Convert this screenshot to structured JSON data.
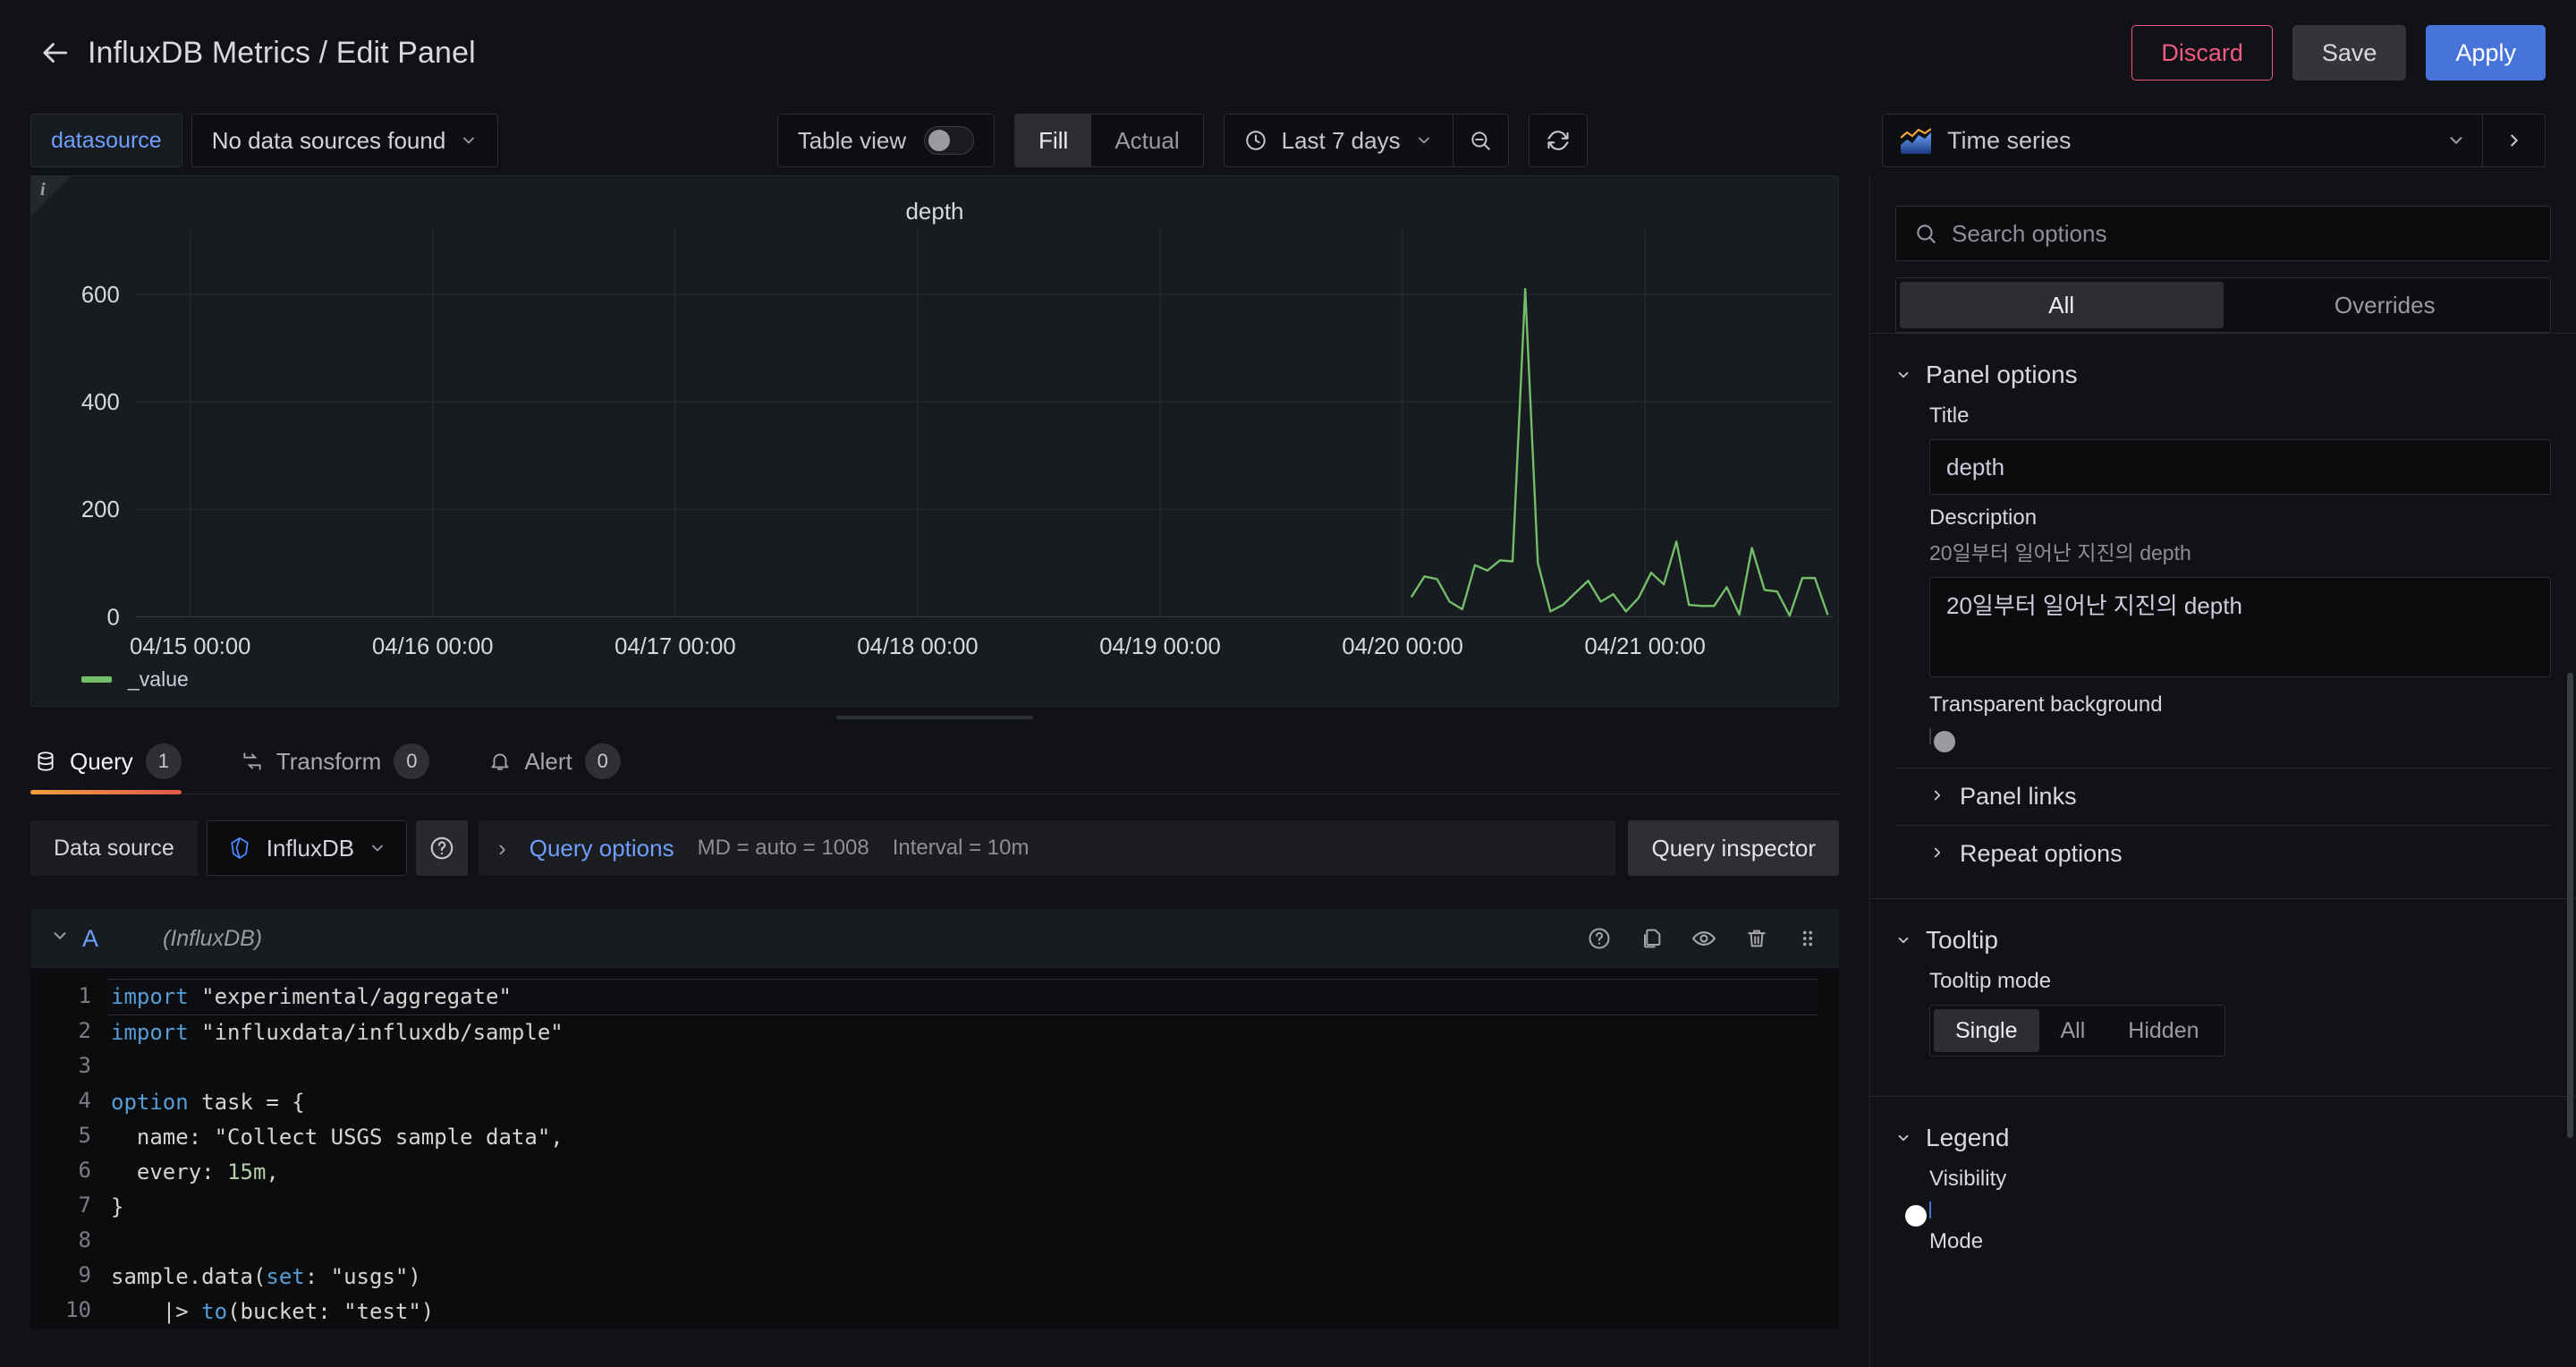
{
  "header": {
    "back_icon": "arrow-left-icon",
    "title": "InfluxDB Metrics / Edit Panel",
    "discard_label": "Discard",
    "save_label": "Save",
    "apply_label": "Apply",
    "discard_color": "#f45b82",
    "apply_color": "#4674db"
  },
  "toolbar": {
    "datasource_tag": "datasource",
    "datasource_value": "No data sources found",
    "table_view_label": "Table view",
    "table_view_on": false,
    "fill_label": "Fill",
    "actual_label": "Actual",
    "fill_actual_selected": "Fill",
    "time_range": "Last 7 days",
    "zoom_out_icon": "zoom-out-icon",
    "refresh_icon": "refresh-icon",
    "clock_icon": "clock-icon",
    "viz_type": "Time series",
    "viz_icon": "time-series-icon"
  },
  "panel": {
    "info_icon": "info-icon",
    "title": "depth"
  },
  "chart_data": {
    "type": "line",
    "title": "depth",
    "xlabel": "",
    "ylabel": "",
    "grid": true,
    "legend_position": "bottom-left",
    "series": [
      {
        "name": "_value",
        "color": "#73bf69",
        "values": [
          null,
          null,
          null,
          null,
          null,
          null,
          null,
          null,
          null,
          null,
          null,
          null,
          null,
          null,
          null,
          null,
          null,
          null,
          null,
          null,
          null,
          null,
          null,
          null,
          null,
          null,
          null,
          null,
          null,
          null,
          null,
          null,
          null,
          null,
          null,
          null,
          null,
          null,
          null,
          null,
          null,
          null,
          null,
          null,
          null,
          null,
          null,
          null,
          null,
          null,
          null,
          null,
          null,
          null,
          null,
          null,
          null,
          null,
          null,
          null,
          null,
          null,
          null,
          null,
          null,
          null,
          null,
          null,
          null,
          null,
          null,
          null,
          null,
          null,
          null,
          null,
          null,
          null,
          null,
          null,
          null,
          null,
          null,
          null,
          null,
          null,
          null,
          null,
          null,
          null,
          null,
          null,
          null,
          null,
          null,
          null,
          null,
          null,
          null,
          null,
          null,
          null,
          null,
          null,
          null,
          null,
          null,
          null,
          null,
          null,
          null,
          null,
          null,
          null,
          null,
          null,
          null,
          null,
          null,
          null,
          null,
          null,
          null,
          null,
          null,
          null,
          null,
          null,
          null,
          null,
          null,
          null,
          null,
          null,
          null,
          null,
          null,
          null,
          null,
          null,
          null,
          null,
          null,
          null,
          null,
          null,
          null,
          null,
          null,
          null,
          null,
          null,
          null,
          null,
          null,
          null,
          null,
          null,
          null,
          null,
          null,
          null,
          null,
          null,
          null,
          null,
          null,
          null,
          null,
          null,
          null,
          null,
          null,
          null,
          null,
          null,
          null,
          null,
          null,
          null,
          null,
          null,
          null,
          null,
          null,
          null,
          null,
          null,
          null,
          null,
          null,
          null,
          null,
          null,
          null,
          null,
          null,
          null,
          null,
          null,
          null,
          null,
          null,
          null,
          null,
          null,
          null,
          null,
          null,
          null,
          null,
          null,
          null,
          null,
          null,
          null,
          null,
          null,
          null,
          null,
          null,
          null,
          null,
          null,
          null,
          null,
          null,
          null,
          null,
          null,
          null,
          null,
          null,
          null,
          null,
          null,
          null,
          null,
          null,
          null,
          null,
          null,
          null,
          null,
          null,
          null,
          null,
          null,
          null,
          null,
          null,
          null,
          null,
          null,
          null,
          null,
          null,
          null,
          null,
          null,
          null,
          null,
          null,
          null,
          null,
          null,
          null,
          null,
          null,
          null,
          null,
          null,
          null,
          null,
          null,
          null,
          null,
          null,
          null,
          null,
          null,
          null,
          null,
          null,
          null,
          null,
          null,
          null,
          null,
          null,
          null,
          null,
          null,
          null,
          null,
          null,
          null,
          null,
          null,
          null,
          null,
          null,
          null,
          null,
          null,
          null,
          null,
          null,
          null,
          null,
          null,
          null,
          null,
          null,
          null,
          null,
          null,
          null,
          null,
          null,
          null,
          null,
          null,
          null,
          null,
          null,
          null,
          null,
          null,
          null,
          null,
          null,
          null,
          null,
          null,
          null,
          null,
          null,
          null,
          null,
          null,
          null,
          null,
          null,
          null,
          null,
          null,
          null,
          null,
          null,
          null,
          null,
          null,
          null,
          null,
          null,
          null,
          null,
          null,
          null,
          null,
          null,
          null,
          null,
          null,
          null,
          null,
          null,
          null,
          null,
          null,
          null,
          null,
          null,
          null,
          null,
          null,
          null,
          null,
          null,
          null,
          null,
          null,
          null,
          null,
          null,
          null,
          null,
          null,
          null,
          null,
          null,
          null,
          null,
          null,
          null,
          null,
          null,
          null,
          null,
          null,
          null,
          null,
          null,
          null,
          null,
          null,
          null,
          null,
          null,
          null,
          null,
          null,
          null,
          null,
          null,
          null,
          null,
          null,
          null,
          null,
          null,
          null,
          null,
          null,
          null,
          null,
          null,
          null,
          null,
          null,
          null,
          null,
          null,
          null,
          null,
          null,
          null,
          null,
          null,
          null,
          null,
          null,
          null,
          null,
          null,
          null,
          null,
          null,
          null,
          null,
          null,
          null,
          null,
          null,
          null,
          null,
          null,
          null,
          null,
          null,
          null,
          null,
          null,
          null,
          null,
          null,
          null,
          null,
          null,
          null,
          null,
          null,
          null,
          null,
          null,
          null,
          null,
          null,
          null,
          null,
          null,
          null,
          null,
          null,
          null,
          null,
          null,
          null,
          null,
          null,
          null,
          null,
          null,
          null,
          null,
          null,
          null,
          null,
          null
        ]
      }
    ],
    "points": [
      {
        "t": "04/20 04:00",
        "v": 38
      },
      {
        "t": "04/20 05:30",
        "v": 75
      },
      {
        "t": "04/20 06:30",
        "v": 70
      },
      {
        "t": "04/20 08:00",
        "v": 28
      },
      {
        "t": "04/20 09:00",
        "v": 14
      },
      {
        "t": "04/20 10:30",
        "v": 96
      },
      {
        "t": "04/20 11:30",
        "v": 86
      },
      {
        "t": "04/20 12:30",
        "v": 105
      },
      {
        "t": "04/20 13:30",
        "v": 103
      },
      {
        "t": "04/20 14:30",
        "v": 610
      },
      {
        "t": "04/20 15:30",
        "v": 100
      },
      {
        "t": "04/20 16:00",
        "v": 10
      },
      {
        "t": "04/20 17:30",
        "v": 22
      },
      {
        "t": "04/20 19:00",
        "v": 45
      },
      {
        "t": "04/20 20:00",
        "v": 67
      },
      {
        "t": "04/20 21:00",
        "v": 28
      },
      {
        "t": "04/20 22:00",
        "v": 42
      },
      {
        "t": "04/20 23:00",
        "v": 10
      },
      {
        "t": "04/21 00:30",
        "v": 35
      },
      {
        "t": "04/21 01:30",
        "v": 82
      },
      {
        "t": "04/21 02:00",
        "v": 60
      },
      {
        "t": "04/21 03:00",
        "v": 140
      },
      {
        "t": "04/21 04:00",
        "v": 22
      },
      {
        "t": "04/21 05:30",
        "v": 20
      },
      {
        "t": "04/21 07:00",
        "v": 20
      },
      {
        "t": "04/21 08:00",
        "v": 55
      },
      {
        "t": "04/21 08:30",
        "v": 4
      },
      {
        "t": "04/21 09:30",
        "v": 128
      },
      {
        "t": "04/21 10:30",
        "v": 50
      },
      {
        "t": "04/21 11:30",
        "v": 47
      },
      {
        "t": "04/21 12:30",
        "v": 2
      },
      {
        "t": "04/21 13:30",
        "v": 72
      },
      {
        "t": "04/21 14:30",
        "v": 72
      },
      {
        "t": "04/21 16:00",
        "v": 5
      }
    ],
    "yticks": [
      0,
      200,
      400,
      600
    ],
    "ylim": [
      0,
      700
    ],
    "xticks": [
      "04/15 00:00",
      "04/16 00:00",
      "04/17 00:00",
      "04/18 00:00",
      "04/19 00:00",
      "04/20 00:00",
      "04/21 00:00"
    ],
    "legend": [
      {
        "label": "_value",
        "color": "#73bf69"
      }
    ]
  },
  "tabs": [
    {
      "label": "Query",
      "badge": "1",
      "icon": "database-icon",
      "active": true
    },
    {
      "label": "Transform",
      "badge": "0",
      "icon": "transform-icon",
      "active": false
    },
    {
      "label": "Alert",
      "badge": "0",
      "icon": "bell-icon",
      "active": false
    }
  ],
  "query": {
    "datasource_label": "Data source",
    "datasource_value": "InfluxDB",
    "help_icon": "question-circle-icon",
    "query_options_label": "Query options",
    "max_data_points": "MD = auto = 1008",
    "interval": "Interval = 10m",
    "query_inspector_label": "Query inspector",
    "row_letter": "A",
    "row_datasource": "(InfluxDB)",
    "row_icons": [
      "question-circle-icon",
      "duplicate-icon",
      "eye-icon",
      "trash-icon",
      "drag-handle-icon"
    ],
    "code_lines": [
      {
        "n": "1",
        "text": "import \"experimental/aggregate\""
      },
      {
        "n": "2",
        "text": "import \"influxdata/influxdb/sample\""
      },
      {
        "n": "3",
        "text": ""
      },
      {
        "n": "4",
        "text": "option task = {"
      },
      {
        "n": "5",
        "text": "  name: \"Collect USGS sample data\","
      },
      {
        "n": "6",
        "text": "  every: 15m,"
      },
      {
        "n": "7",
        "text": "}"
      },
      {
        "n": "8",
        "text": ""
      },
      {
        "n": "9",
        "text": "sample.data(set: \"usgs\")"
      },
      {
        "n": "10",
        "text": "    |> to(bucket: \"test\")"
      }
    ]
  },
  "options": {
    "search_placeholder": "Search options",
    "search_icon": "search-icon",
    "all_label": "All",
    "overrides_label": "Overrides",
    "selected_scope": "All",
    "panel_options": {
      "title": "Panel options",
      "title_field_label": "Title",
      "title_value": "depth",
      "description_label": "Description",
      "description_help": "20일부터 일어난 지진의 depth",
      "description_value": "20일부터 일어난 지진의 depth",
      "transparent_label": "Transparent background",
      "transparent_on": false,
      "panel_links_label": "Panel links",
      "repeat_options_label": "Repeat options"
    },
    "tooltip": {
      "title": "Tooltip",
      "mode_label": "Tooltip mode",
      "modes": [
        "Single",
        "All",
        "Hidden"
      ],
      "selected_mode": "Single"
    },
    "legend": {
      "title": "Legend",
      "visibility_label": "Visibility",
      "visibility_on": true,
      "mode_label": "Mode"
    }
  }
}
